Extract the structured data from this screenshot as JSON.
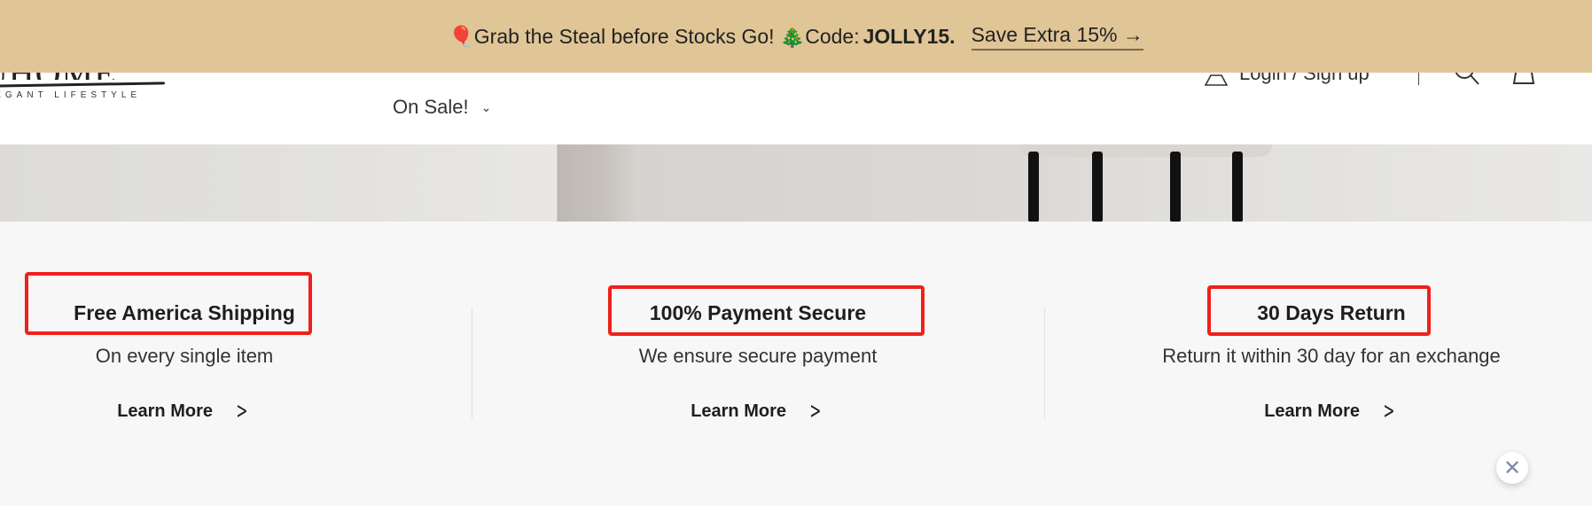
{
  "banner": {
    "balloon_icon": "🎈",
    "text": "Grab the Steal before Stocks Go!",
    "tree_icon": "🎄",
    "code_label": "Code:",
    "code": "JOLLY15.",
    "link": "Save Extra 15% →",
    "bg": "#e0c596"
  },
  "header": {
    "logo_text": "OUHOME",
    "logo_tagline": "ELEGANT LIFESTYLE",
    "nav_sale": "On Sale!",
    "nav_chevron": "⌄",
    "login": "Login / Sign up"
  },
  "features": [
    {
      "title": "Free America Shipping",
      "subtitle": "On every single item",
      "link": "Learn More"
    },
    {
      "title": "100% Payment Secure",
      "subtitle": "We ensure secure payment",
      "link": "Learn More"
    },
    {
      "title": "30 Days Return",
      "subtitle": "Return it within 30 day for an exchange",
      "link": "Learn More"
    }
  ],
  "close_icon": "✕",
  "highlight_color": "#f0201a"
}
